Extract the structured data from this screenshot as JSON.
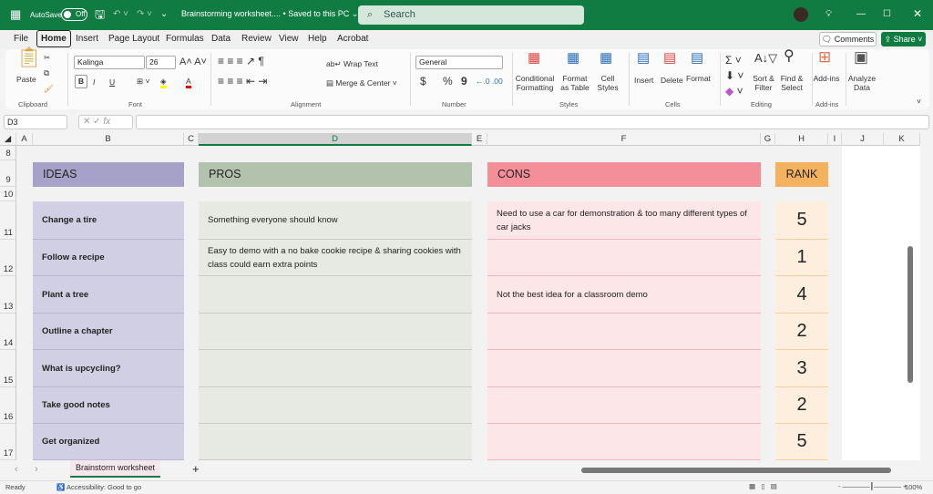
{
  "titlebar": {
    "autosave": "AutoSave",
    "autosave_state": "Off",
    "doc_title": "Brainstorming worksheet.... • Saved to this PC ⌄",
    "search_placeholder": "Search",
    "brand_color": "#107c41"
  },
  "menu": [
    "File",
    "Home",
    "Insert",
    "Page Layout",
    "Formulas",
    "Data",
    "Review",
    "View",
    "Help",
    "Acrobat"
  ],
  "actions": {
    "comments": "Comments",
    "share": "Share"
  },
  "ribbon": {
    "clipboard": {
      "paste": "Paste",
      "group": "Clipboard"
    },
    "font": {
      "name": "Kalinga",
      "size": "26",
      "group": "Font",
      "bold": "B",
      "italic": "I",
      "underline": "U"
    },
    "alignment": {
      "wrap": "Wrap Text",
      "merge": "Merge & Center",
      "group": "Alignment"
    },
    "number": {
      "format": "General",
      "group": "Number",
      "currency": "$",
      "percent": "%",
      "comma": "9"
    },
    "styles": {
      "conditional": "Conditional Formatting",
      "format_table": "Format as Table",
      "cell_styles": "Cell Styles",
      "group": "Styles"
    },
    "cells": {
      "insert": "Insert",
      "delete": "Delete",
      "format": "Format",
      "group": "Cells"
    },
    "editing": {
      "sort": "Sort & Filter",
      "find": "Find & Select",
      "group": "Editing"
    },
    "addins": {
      "addins": "Add-ins",
      "group": "Add-ins"
    },
    "analyze": {
      "label": "Analyze Data"
    }
  },
  "formula": {
    "namebox": "D3",
    "fx": "fx",
    "value": ""
  },
  "columns": [
    "A",
    "B",
    "C",
    "D",
    "E",
    "F",
    "G",
    "H",
    "I",
    "J",
    "K"
  ],
  "rows": [
    "8",
    "9",
    "10",
    "11",
    "12",
    "13",
    "14",
    "15",
    "16",
    "17"
  ],
  "headers": {
    "ideas": "IDEAS",
    "pros": "PROS",
    "cons": "CONS",
    "rank": "RANK"
  },
  "colors": {
    "ideas_header": "#a5a1c8",
    "ideas_cell": "#d1cfe4",
    "pros_header": "#b3c2ad",
    "pros_cell": "#e6eae2",
    "cons_header": "#f48f99",
    "cons_cell": "#fce6e8",
    "rank_header": "#f5b25e",
    "rank_cell": "#fdeedd"
  },
  "entries": [
    {
      "idea": "Change a tire",
      "pro": "Something everyone should know",
      "con": "Need to use a car for demonstration & too many different types of car jacks",
      "rank": "5"
    },
    {
      "idea": "Follow a recipe",
      "pro": "Easy to demo with a no bake cookie recipe & sharing cookies with class could earn extra points",
      "con": "",
      "rank": "1"
    },
    {
      "idea": "Plant a tree",
      "pro": "",
      "con": "Not the best idea for a classroom demo",
      "rank": "4"
    },
    {
      "idea": "Outline a chapter",
      "pro": "",
      "con": "",
      "rank": "2"
    },
    {
      "idea": "What is upcycling?",
      "pro": "",
      "con": "",
      "rank": "3"
    },
    {
      "idea": "Take good notes",
      "pro": "",
      "con": "",
      "rank": "2"
    },
    {
      "idea": "Get organized",
      "pro": "",
      "con": "",
      "rank": "5"
    }
  ],
  "sheet_tab": "Brainstorm worksheet",
  "status": {
    "ready": "Ready",
    "accessibility": "Accessibility: Good to go",
    "zoom": "100%"
  }
}
